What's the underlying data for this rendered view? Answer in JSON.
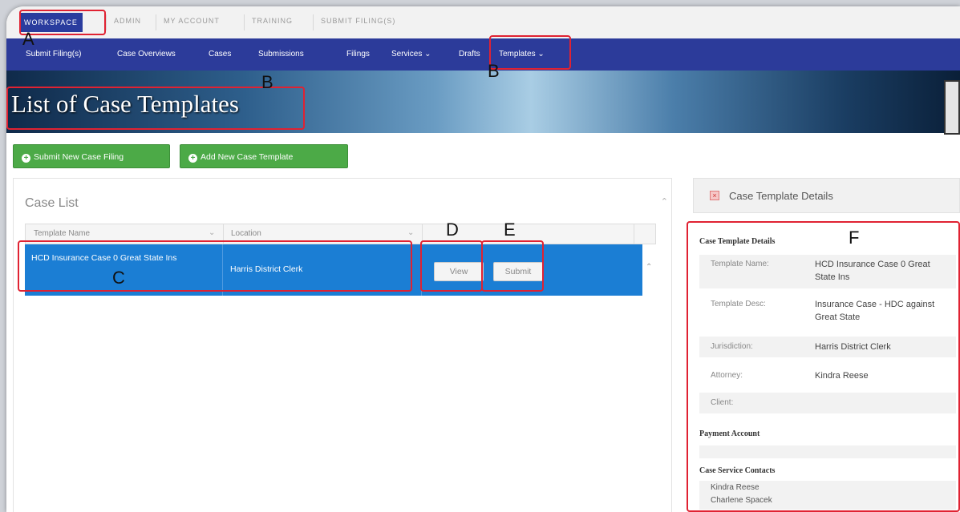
{
  "top_nav": [
    "WORKSPACE",
    "ADMIN",
    "MY ACCOUNT",
    "TRAINING",
    "SUBMIT FILING(S)"
  ],
  "sub_nav": [
    "Submit Filing(s)",
    "Case Overviews",
    "Cases",
    "Submissions",
    "Filings",
    "Services ⌄",
    "Drafts",
    "Templates ⌄"
  ],
  "banner": {
    "title": "List of Case Templates"
  },
  "actions": {
    "submit_new": "Submit New Case Filing",
    "add_template": "Add New Case Template"
  },
  "case_list": {
    "title": "Case List",
    "columns": [
      "Template Name",
      "Location"
    ],
    "rows": [
      {
        "template_name": "HCD Insurance Case 0 Great State Ins",
        "location": "Harris District Clerk",
        "view_label": "View",
        "submit_label": "Submit"
      }
    ]
  },
  "details_panel": {
    "header": "Case Template Details",
    "section_title": "Case Template Details",
    "fields": [
      {
        "label": "Template Name:",
        "value": "HCD Insurance Case 0 Great State Ins"
      },
      {
        "label": "Template Desc:",
        "value": "Insurance Case - HDC against Great State"
      },
      {
        "label": "Jurisdiction:",
        "value": "Harris District Clerk"
      },
      {
        "label": "Attorney:",
        "value": "Kindra Reese"
      },
      {
        "label": "Client:",
        "value": ""
      }
    ],
    "payment_title": "Payment Account",
    "contacts_title": "Case Service Contacts",
    "contacts": [
      "Kindra Reese",
      "Charlene Spacek"
    ]
  },
  "annotations": [
    "A",
    "B",
    "B",
    "C",
    "D",
    "E",
    "F"
  ],
  "colors": {
    "nav_blue": "#2c3b9a",
    "row_blue": "#1b7ed4",
    "button_green": "#4caa47",
    "annotation_red": "#e02232"
  }
}
